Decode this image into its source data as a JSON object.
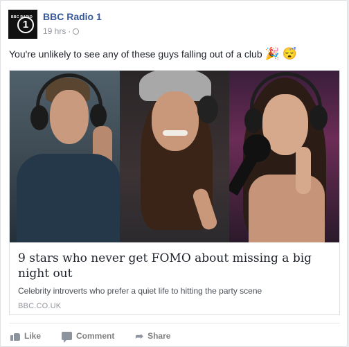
{
  "post": {
    "page_name": "BBC Radio 1",
    "avatar_text": "BBC RADIO",
    "avatar_number": "1",
    "timestamp": "19 hrs",
    "separator": "·",
    "message": "You're unlikely to see any of these guys falling out of a club",
    "emojis": [
      "🎉",
      "😴"
    ]
  },
  "link_preview": {
    "headline": "9 stars who never get FOMO about missing a big night out",
    "description": "Celebrity introverts who prefer a quiet life to hitting the party scene",
    "domain": "BBC.CO.UK"
  },
  "actions": {
    "like": "Like",
    "comment": "Comment",
    "share": "Share"
  },
  "icons": {
    "avatar": "bbc-radio-1-logo",
    "privacy": "globe-icon",
    "like": "thumbs-up-icon",
    "comment": "comment-bubble-icon",
    "share": "share-arrow-icon"
  },
  "colors": {
    "page_name": "#365899",
    "meta": "#90949c",
    "text": "#1d2129",
    "action": "#7f7f7f"
  }
}
